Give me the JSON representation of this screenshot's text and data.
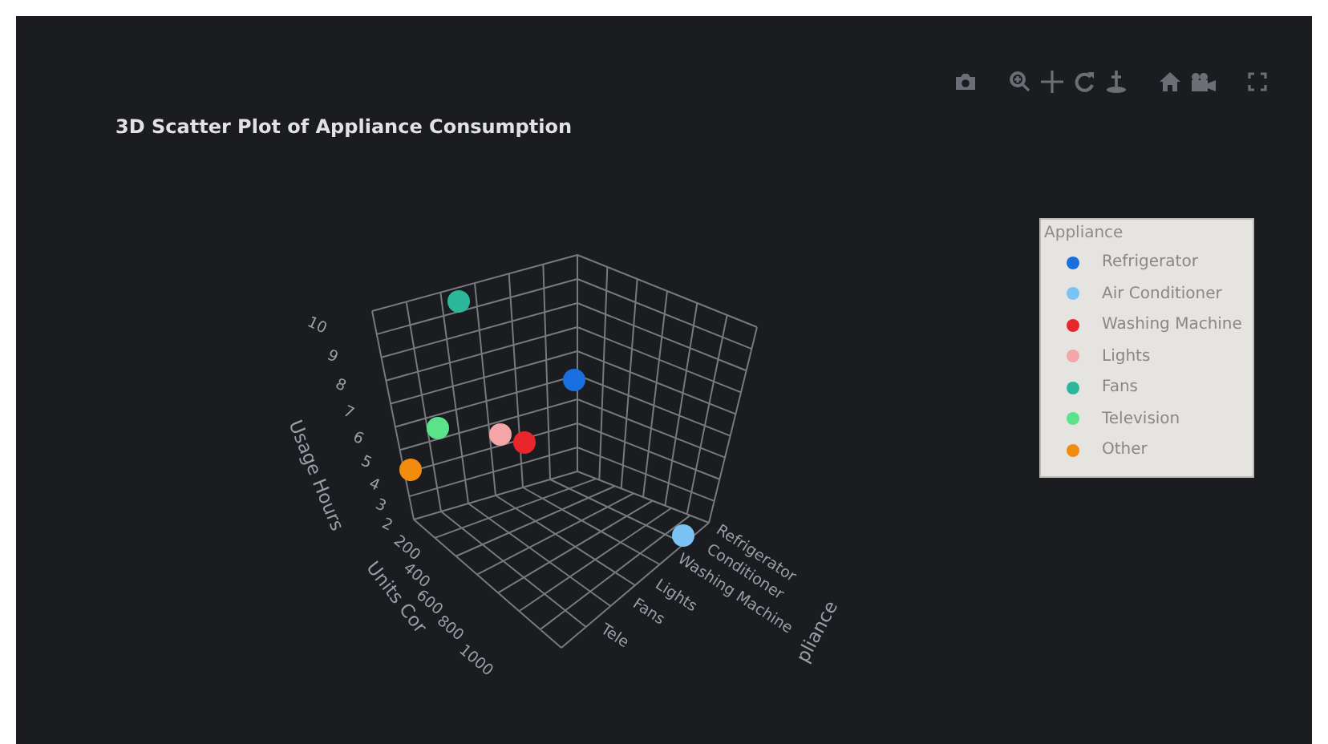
{
  "title": "3D Scatter Plot of Appliance Consumption",
  "scene": {
    "z_axis": {
      "title": "Usage Hours",
      "ticks": [
        "10",
        "9",
        "8",
        "7",
        "6",
        "5",
        "4",
        "3",
        "2"
      ]
    },
    "y_axis": {
      "title": "Units Cor",
      "ticks": [
        "200",
        "400",
        "600",
        "800",
        "1000"
      ]
    },
    "x_axis": {
      "title": "pliance",
      "ticks": [
        "Refrigerator",
        "Conditioner",
        "Washing Machine",
        "Lights",
        "Fans",
        "Tele"
      ]
    }
  },
  "legend": {
    "title": "Appliance",
    "items": [
      {
        "label": "Refrigerator",
        "color": "#1a6fe0"
      },
      {
        "label": "Air Conditioner",
        "color": "#7cc3f5"
      },
      {
        "label": "Washing Machine",
        "color": "#e8262b"
      },
      {
        "label": "Lights",
        "color": "#f4a5a8"
      },
      {
        "label": "Fans",
        "color": "#2bb89a"
      },
      {
        "label": "Television",
        "color": "#5be38a"
      },
      {
        "label": "Other",
        "color": "#f28c0f"
      }
    ]
  }
}
